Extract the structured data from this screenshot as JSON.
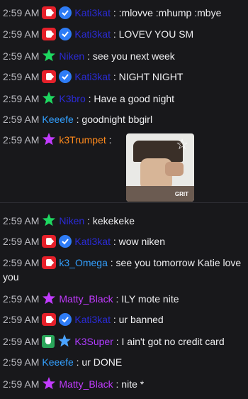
{
  "messages": [
    {
      "time": "2:59 AM",
      "badges": [
        "youtube-icon",
        "verified-icon"
      ],
      "user": "Kati3kat",
      "userColor": "#2b2bd6",
      "text": ":mlovve :mhump :mbye"
    },
    {
      "time": "2:59 AM",
      "badges": [
        "youtube-icon",
        "verified-icon"
      ],
      "user": "Kati3kat",
      "userColor": "#2b2bd6",
      "text": "LOVEV YOU SM"
    },
    {
      "time": "2:59 AM",
      "badges": [
        "green-star-icon"
      ],
      "user": "Niken",
      "userColor": "#2b2bd6",
      "text": "see you next week"
    },
    {
      "time": "2:59 AM",
      "badges": [
        "youtube-icon",
        "verified-icon"
      ],
      "user": "Kati3kat",
      "userColor": "#2b2bd6",
      "text": "NIGHT NIGHT"
    },
    {
      "time": "2:59 AM",
      "badges": [
        "green-star-icon"
      ],
      "user": "K3bro",
      "userColor": "#2b2bd6",
      "text": "Have a good night"
    },
    {
      "time": "2:59 AM",
      "badges": [],
      "user": "Keeefe",
      "userColor": "#33a0ff",
      "text": "goodnight bbgirl"
    },
    {
      "time": "2:59 AM",
      "badges": [
        "purple-star-icon"
      ],
      "user": "k3Trumpet",
      "userColor": "#ff8a1c",
      "text": ""
    },
    {
      "time": "2:59 AM",
      "badges": [
        "green-star-icon"
      ],
      "user": "Niken",
      "userColor": "#2b2bd6",
      "text": "kekekeke"
    },
    {
      "time": "2:59 AM",
      "badges": [
        "youtube-icon",
        "verified-icon"
      ],
      "user": "Kati3kat",
      "userColor": "#2b2bd6",
      "text": "wow niken"
    },
    {
      "time": "2:59 AM",
      "badges": [
        "youtube-icon"
      ],
      "user": "k3_Omega",
      "userColor": "#33a0ff",
      "text": "see you tomorrow Katie love you"
    },
    {
      "time": "2:59 AM",
      "badges": [
        "purple-star-icon"
      ],
      "user": "Matty_Black",
      "userColor": "#c23bff",
      "text": "ILY mote nite"
    },
    {
      "time": "2:59 AM",
      "badges": [
        "youtube-icon",
        "verified-icon"
      ],
      "user": "Kati3kat",
      "userColor": "#2b2bd6",
      "text": "ur banned"
    },
    {
      "time": "2:59 AM",
      "badges": [
        "shield-icon",
        "blue-star-icon"
      ],
      "user": "K3Super",
      "userColor": "#b03cff",
      "text": "I ain't got no credit card"
    },
    {
      "time": "2:59 AM",
      "badges": [],
      "user": "Keeefe",
      "userColor": "#33a0ff",
      "text": "ur DONE"
    },
    {
      "time": "2:59 AM",
      "badges": [
        "purple-star-icon"
      ],
      "user": "Matty_Black",
      "userColor": "#c23bff",
      "text": "nite *"
    }
  ],
  "emote": {
    "watermark": "GRIT"
  }
}
